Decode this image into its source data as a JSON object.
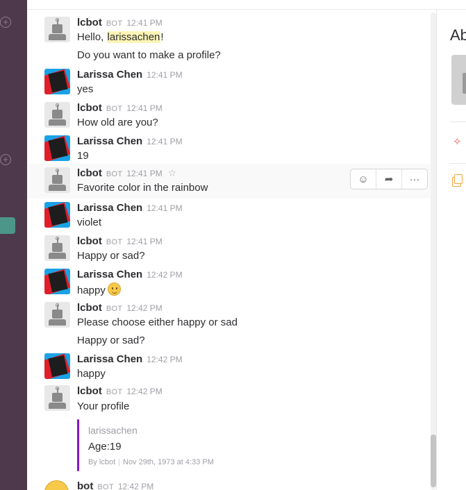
{
  "messages": [
    {
      "name": "lcbot",
      "badge": "BOT",
      "time": "12:41 PM",
      "text_before": "Hello, ",
      "mention": "larissachen",
      "text_after": "!",
      "text2": "Do you want to make a profile?"
    },
    {
      "name": "Larissa Chen",
      "time": "12:41 PM",
      "text": "yes"
    },
    {
      "name": "lcbot",
      "badge": "BOT",
      "time": "12:41 PM",
      "text": "How old are you?"
    },
    {
      "name": "Larissa Chen",
      "time": "12:41 PM",
      "text": "19"
    },
    {
      "name": "lcbot",
      "badge": "BOT",
      "time": "12:41 PM",
      "text": "Favorite color in the rainbow"
    },
    {
      "name": "Larissa Chen",
      "time": "12:41 PM",
      "text": "violet"
    },
    {
      "name": "lcbot",
      "badge": "BOT",
      "time": "12:41 PM",
      "text": "Happy or sad?"
    },
    {
      "name": "Larissa Chen",
      "time": "12:42 PM",
      "text": "happy"
    },
    {
      "name": "lcbot",
      "badge": "BOT",
      "time": "12:42 PM",
      "text": "Please choose either happy or sad",
      "text2": "Happy or sad?"
    },
    {
      "name": "Larissa Chen",
      "time": "12:42 PM",
      "text": "happy"
    },
    {
      "name": "lcbot",
      "badge": "BOT",
      "time": "12:42 PM",
      "text": "Your profile"
    },
    {
      "name": "bot",
      "badge": "BOT",
      "time": "12:42 PM"
    }
  ],
  "attachment": {
    "title": "larissachen",
    "body": "Age:19",
    "footer_by": "By lcbot",
    "footer_date": "Nov 29th, 1973 at 4:33 PM",
    "bar_color": "#8a14c6"
  },
  "hover_actions": {
    "star_icon": "star-icon",
    "reaction_icon": "add-reaction-icon",
    "share_icon": "share-icon",
    "more_icon": "more-icon"
  },
  "right_panel": {
    "title": "Ab"
  },
  "colors": {
    "sidebar": "#4d394b",
    "active_channel": "#4c9689",
    "mention_highlight": "#fcf4b6"
  }
}
